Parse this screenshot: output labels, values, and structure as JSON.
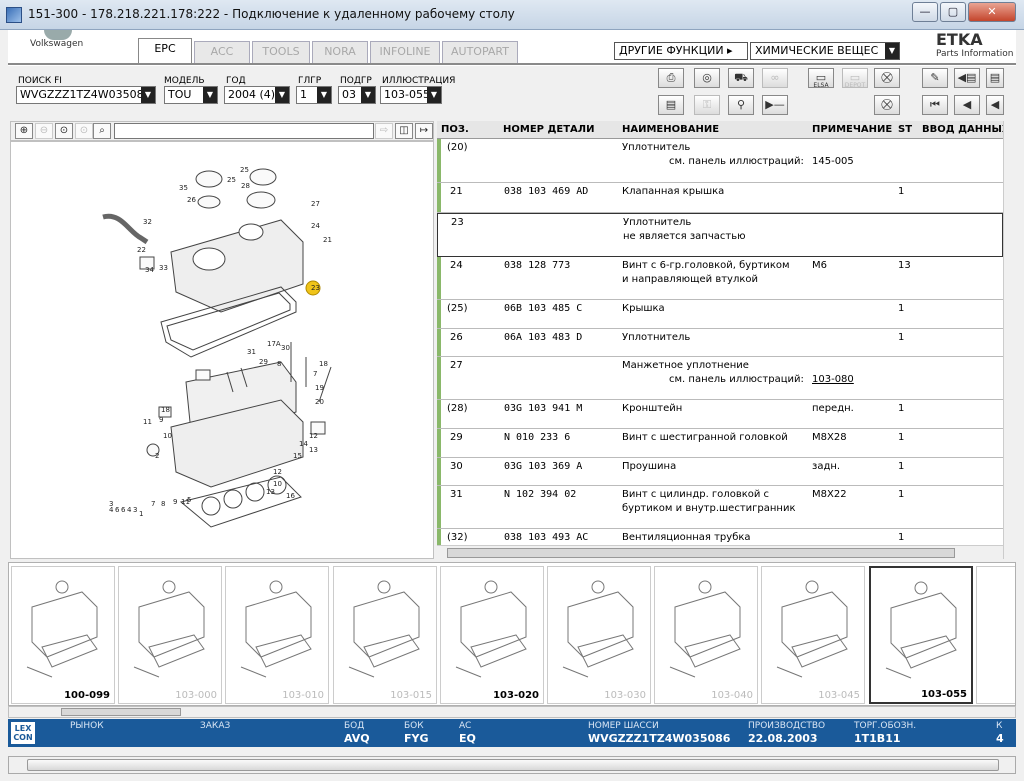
{
  "window": {
    "title": "151-300 - 178.218.221.178:222 - Подключение к удаленному рабочему столу"
  },
  "brand": {
    "logo_text": "Volkswagen",
    "etka": "ETKA",
    "parts_info": "Parts Information"
  },
  "tabs": [
    {
      "label": "EPC",
      "active": true
    },
    {
      "label": "ACC"
    },
    {
      "label": "TOOLS"
    },
    {
      "label": "NORA"
    },
    {
      "label": "INFOLINE"
    },
    {
      "label": "AUTOPART"
    }
  ],
  "functions": {
    "other_label": "ДРУГИЕ ФУНКЦИИ ▸",
    "chem_value": "ХИМИЧЕСКИЕ ВЕЩЕС"
  },
  "filters": {
    "search_fi": {
      "label": "ПОИСК FI",
      "value": "WVGZZZ1TZ4W03508"
    },
    "model": {
      "label": "МОДЕЛЬ",
      "value": "TOU"
    },
    "year": {
      "label": "ГОД",
      "value": "2004 (4)"
    },
    "glgr": {
      "label": "ГЛГР",
      "value": "1"
    },
    "podgr": {
      "label": "ПОДГР",
      "value": "03"
    },
    "illustration": {
      "label": "ИЛЛЮСТРАЦИЯ",
      "value": "103-055"
    }
  },
  "toolbar": {
    "elsa": "ELSA",
    "depot": "DEPOT"
  },
  "parts_table": {
    "headers": {
      "pos": "ПОЗ.",
      "part_no": "НОМЕР ДЕТАЛИ",
      "name": "НАИМЕНОВАНИЕ",
      "note": "ПРИМЕЧАНИЕ",
      "st": "ST",
      "input": "ВВОД ДАННЫХ"
    },
    "rows": [
      {
        "pos": "(20)",
        "part_no": "",
        "name": "Уплотнитель",
        "name2": "см. панель иллюстраций:",
        "note": "145-005",
        "st": ""
      },
      {
        "pos": "21",
        "part_no": "038  103  469  AD",
        "name": "Клапанная крышка",
        "name2": "",
        "note": "",
        "st": "1"
      },
      {
        "pos": "23",
        "part_no": "",
        "name": "Уплотнитель",
        "name2": "не является запчастью",
        "note": "",
        "st": ""
      },
      {
        "pos": "24",
        "part_no": "038  128  773",
        "name": "Винт с 6-гр.головкой, буртиком",
        "name2": "и направляющей втулкой",
        "note": "M6",
        "st": "13"
      },
      {
        "pos": "(25)",
        "part_no": "06B  103  485  C",
        "name": "Крышка",
        "name2": "",
        "note": "",
        "st": "1"
      },
      {
        "pos": "26",
        "part_no": "06A  103  483  D",
        "name": "Уплотнитель",
        "name2": "",
        "note": "",
        "st": "1"
      },
      {
        "pos": "27",
        "part_no": "",
        "name": "Манжетное уплотнение",
        "name2": "см. панель иллюстраций:",
        "note": "103-080",
        "st": ""
      },
      {
        "pos": "(28)",
        "part_no": "03G  103  941  M",
        "name": "Кронштейн",
        "name2": "",
        "note": "передн.",
        "st": "1"
      },
      {
        "pos": "29",
        "part_no": "N    010  233  6",
        "name": "Винт с шестигранной головкой",
        "name2": "",
        "note": "M8X28",
        "st": "1"
      },
      {
        "pos": "30",
        "part_no": "03G  103  369  A",
        "name": "Проушина",
        "name2": "",
        "note": "задн.",
        "st": "1"
      },
      {
        "pos": "31",
        "part_no": "N    102  394  02",
        "name": "Винт с цилиндр. головкой с",
        "name2": "буртиком и внутр.шестигранник",
        "note": "M8X22",
        "st": "1"
      },
      {
        "pos": "(32)",
        "part_no": "038  103  493  AC",
        "name": "Вентиляционная трубка",
        "name2": "",
        "note": "",
        "st": "1"
      }
    ]
  },
  "illustration_labels": [
    "35",
    "25",
    "26",
    "25",
    "28",
    "27",
    "24",
    "21",
    "32",
    "22",
    "33",
    "34",
    "23",
    "31",
    "17A",
    "29",
    "8",
    "30",
    "7",
    "19",
    "18",
    "20",
    "18",
    "16",
    "15",
    "14",
    "12",
    "13",
    "9",
    "11",
    "1",
    "10",
    "2",
    "5",
    "3",
    "4",
    "6",
    "4",
    "3",
    "6",
    "7",
    "8",
    "9",
    "11",
    "12",
    "10",
    "13"
  ],
  "thumbnails": [
    {
      "label": "100-099"
    },
    {
      "label": "103-000"
    },
    {
      "label": "103-010"
    },
    {
      "label": "103-015"
    },
    {
      "label": "103-020"
    },
    {
      "label": "103-030"
    },
    {
      "label": "103-040"
    },
    {
      "label": "103-045"
    },
    {
      "label": "103-055"
    }
  ],
  "status": {
    "lex": "LEX\nCON",
    "market_label": "РЫНОК",
    "market_value": "",
    "order_label": "ЗАКАЗ",
    "order_value": "",
    "bod_label": "БОД",
    "bod_value": "AVQ",
    "bok_label": "БОК",
    "bok_value": "FYG",
    "ac_label": "AC",
    "ac_value": "EQ",
    "chassis_label": "НОМЕР ШАССИ",
    "chassis_value": "WVGZZZ1TZ4W035086",
    "prod_label": "ПРОИЗВОДСТВО",
    "prod_value": "22.08.2003",
    "trade_label": "ТОРГ.ОБОЗН.",
    "trade_value": "1T1B11",
    "k_label": "К",
    "k_value": "4"
  }
}
